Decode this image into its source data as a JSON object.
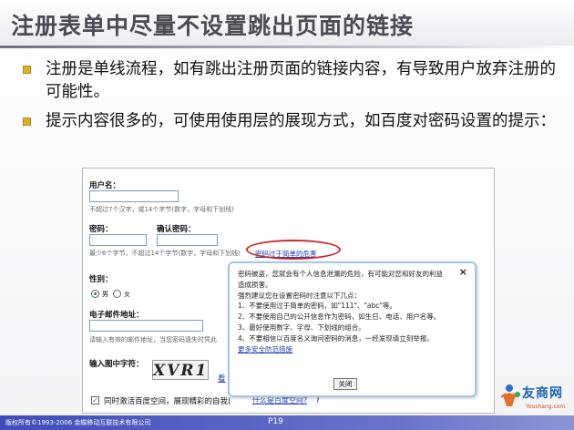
{
  "slide": {
    "title": "注册表单中尽量不设置跳出页面的链接",
    "bullets": [
      "注册是单线流程，如有跳出注册页面的链接内容，有导致用户放弃注册的可能性。",
      "提示内容很多的，可使用使用层的展现方式，如百度对密码设置的提示："
    ],
    "page_number": "P19",
    "copyright": "版权所有©1993-2006 金蝶移动互联技术有限公司"
  },
  "form": {
    "username_label": "用户名：",
    "username_hint": "不超过7个汉字，或14个字节(数字，字母和下划线)",
    "password_label": "密码：",
    "confirm_password_label": "确认密码：",
    "password_hint": "最少6个字节，不超过14个字节(数字，字母和下划线)",
    "password_link": "密码过于简单的危害",
    "gender_label": "性别：",
    "gender_options": [
      "男",
      "女"
    ],
    "email_label": "电子邮件地址：",
    "email_hint": "请输入有效的邮件地址，当您密码遗失时凭此",
    "captcha_label": "输入图中字符：",
    "captcha_text": "XVR1",
    "captcha_refresh": "看",
    "agree_text": "同时激活百度空间，展现精彩的自我(",
    "agree_link": "什么是百度空间?",
    "agree_close": ")"
  },
  "popup": {
    "close_symbol": "×",
    "lines": [
      "密码被盗，您就会有个人信息泄漏的危险，有可能对您和好友的利益",
      "造成损害。",
      "强烈建议您在设置密码时注意以下几点：",
      "1、不要使用过于简单的密码，如\"111\"、\"abc\"等。",
      "2、不要使用自己的公开信息作为密码，如生日、电话、用户名等。",
      "3、最好使用数字、字母、下划线的组合。",
      "4、不要相信以百度名义询问密码的消息，一经发现请立刻举报。"
    ],
    "more_link": "更多安全防范措施",
    "close_button": "关闭"
  },
  "logo": {
    "name": "友商网",
    "site": "Youshang.com"
  }
}
